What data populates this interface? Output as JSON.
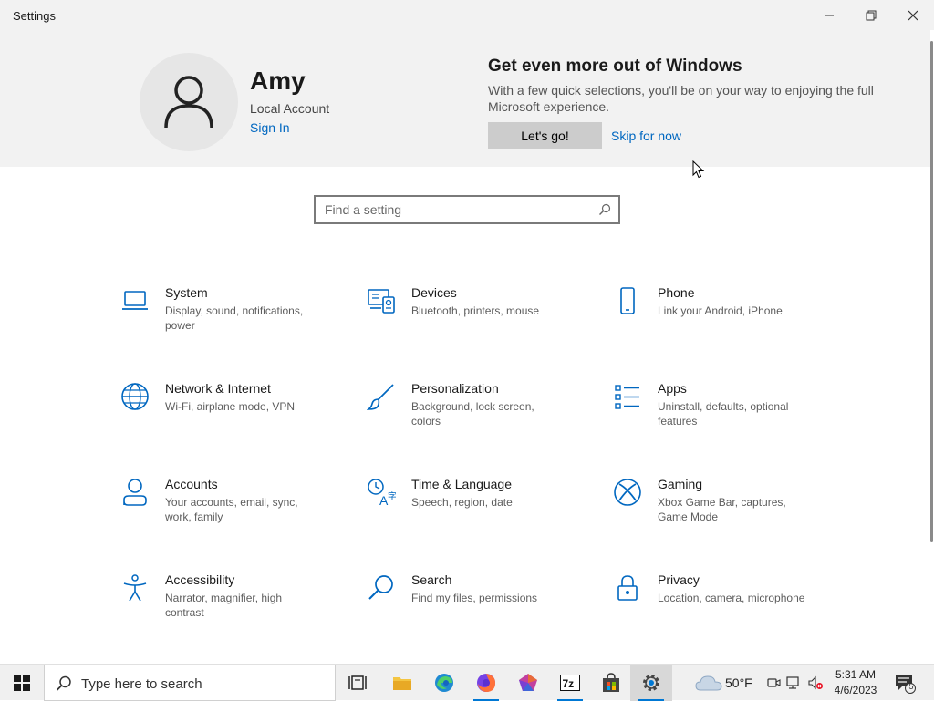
{
  "window": {
    "title": "Settings"
  },
  "account": {
    "name": "Amy",
    "type": "Local Account",
    "sign_in": "Sign In"
  },
  "promo": {
    "title": "Get even more out of Windows",
    "text": "With a few quick selections, you'll be on your way to enjoying the full Microsoft experience.",
    "primary": "Let's go!",
    "secondary": "Skip for now"
  },
  "search": {
    "placeholder": "Find a setting"
  },
  "categories": [
    {
      "name": "System",
      "desc": "Display, sound, notifications, power",
      "icon": "laptop-icon"
    },
    {
      "name": "Devices",
      "desc": "Bluetooth, printers, mouse",
      "icon": "devices-icon"
    },
    {
      "name": "Phone",
      "desc": "Link your Android, iPhone",
      "icon": "phone-icon"
    },
    {
      "name": "Network & Internet",
      "desc": "Wi-Fi, airplane mode, VPN",
      "icon": "globe-icon"
    },
    {
      "name": "Personalization",
      "desc": "Background, lock screen, colors",
      "icon": "brush-icon"
    },
    {
      "name": "Apps",
      "desc": "Uninstall, defaults, optional features",
      "icon": "apps-list-icon"
    },
    {
      "name": "Accounts",
      "desc": "Your accounts, email, sync, work, family",
      "icon": "person-icon"
    },
    {
      "name": "Time & Language",
      "desc": "Speech, region, date",
      "icon": "time-language-icon"
    },
    {
      "name": "Gaming",
      "desc": "Xbox Game Bar, captures, Game Mode",
      "icon": "xbox-icon"
    },
    {
      "name": "Accessibility",
      "desc": "Narrator, magnifier, high contrast",
      "icon": "accessibility-icon"
    },
    {
      "name": "Search",
      "desc": "Find my files, permissions",
      "icon": "search-icon"
    },
    {
      "name": "Privacy",
      "desc": "Location, camera, microphone",
      "icon": "lock-icon"
    }
  ],
  "taskbar": {
    "search_text": "Type here to search",
    "weather": "50°F",
    "time": "5:31 AM",
    "date": "4/6/2023",
    "notification_count": "5"
  },
  "colors": {
    "accent": "#0067c0",
    "icon": "#0067c0",
    "banner": "#f2f2f2"
  }
}
